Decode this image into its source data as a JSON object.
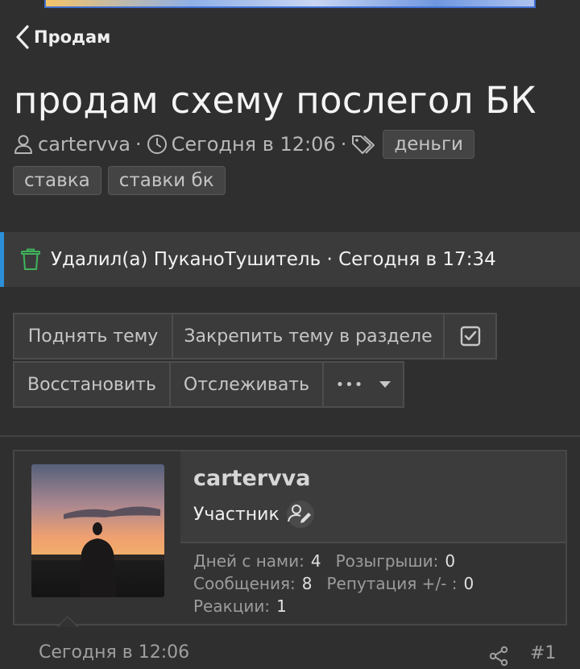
{
  "nav": {
    "back_label": "Продам"
  },
  "thread": {
    "title": "продам схему послегол БК",
    "author": "cartervva",
    "date": "Сегодня в 12:06",
    "tags": [
      "деньги",
      "ставка",
      "ставки бк"
    ]
  },
  "deleted_notice": "Удалил(а) ПуканоТушитель · Сегодня в 17:34",
  "actions": {
    "raise": "Поднять тему",
    "pin": "Закрепить тему в разделе",
    "restore": "Восстановить",
    "watch": "Отслеживать",
    "more": "•••"
  },
  "post": {
    "username": "cartervva",
    "role": "Участник",
    "stats": {
      "days_label": "Дней с нами:",
      "days_value": "4",
      "giveaways_label": "Розыгрыши:",
      "giveaways_value": "0",
      "messages_label": "Сообщения:",
      "messages_value": "8",
      "reputation_label": "Репутация +/- :",
      "reputation_value": "0",
      "reactions_label": "Реакции:",
      "reactions_value": "1"
    },
    "date": "Сегодня в 12:06",
    "number": "#1"
  },
  "colors": {
    "background": "#2f2f2f",
    "accent": "#2c8fd8",
    "deleted_icon": "#3fb45b"
  },
  "icons": [
    "chevron-left-icon",
    "user-icon",
    "clock-icon",
    "tags-icon",
    "trash-icon",
    "checkbox-icon",
    "caret-down-icon",
    "user-edit-icon",
    "share-icon"
  ]
}
